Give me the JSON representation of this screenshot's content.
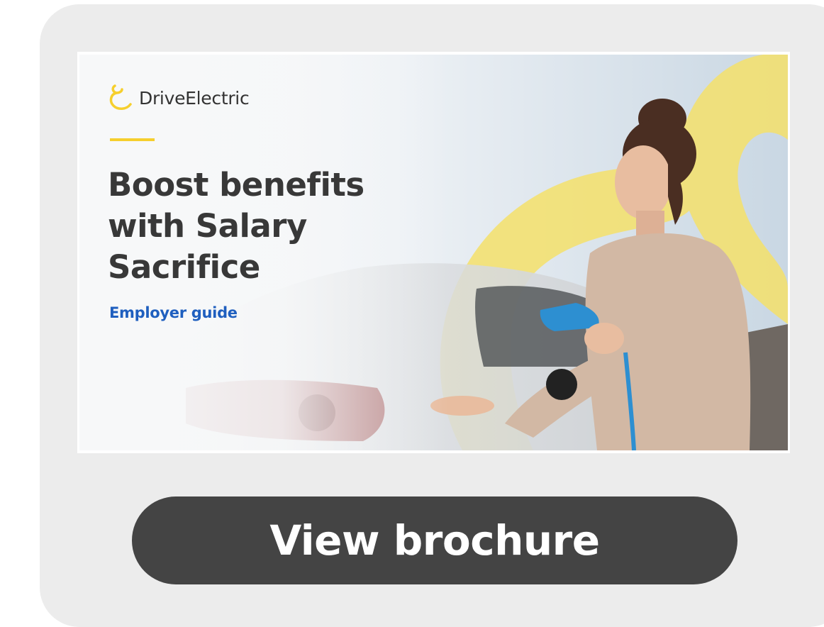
{
  "banner": {
    "brand_name": "DriveElectric",
    "headline_line1": "Boost benefits",
    "headline_line2": "with Salary",
    "headline_line3": "Sacrifice",
    "subheading": "Employer guide",
    "image_alt": "woman-charging-electric-car-photo",
    "colors": {
      "accent_yellow": "#f6cf2d",
      "headline_text": "#383838",
      "subheading_blue": "#1f5fbf"
    }
  },
  "cta": {
    "label": "View brochure",
    "background": "#444444",
    "text_color": "#ffffff"
  },
  "card": {
    "background": "#ececec"
  }
}
